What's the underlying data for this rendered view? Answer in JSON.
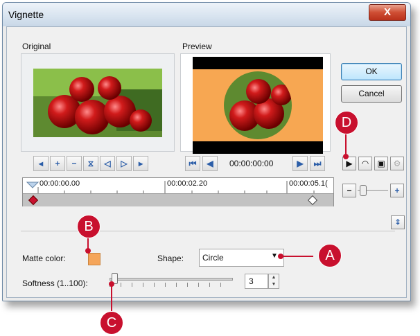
{
  "window": {
    "title": "Vignette",
    "close_label": "X"
  },
  "original": {
    "label": "Original"
  },
  "preview": {
    "label": "Preview",
    "timecode": "00:00:00:00"
  },
  "buttons": {
    "ok": "OK",
    "cancel": "Cancel"
  },
  "timeline": {
    "ticks": [
      "00:00:00.00",
      "00:00:02.20",
      "00:00:05.1("
    ],
    "zoom_minus": "−",
    "zoom_plus": "+"
  },
  "matte": {
    "label": "Matte color:",
    "color": "#f5a55a"
  },
  "shape": {
    "label": "Shape:",
    "value": "Circle"
  },
  "softness": {
    "label": "Softness (1..100):",
    "value": "3",
    "range": [
      1,
      100
    ]
  },
  "callouts": {
    "a": "A",
    "b": "B",
    "c": "C",
    "d": "D"
  },
  "colors": {
    "callout": "#c8102e",
    "preview_bg": "#f7a752"
  }
}
